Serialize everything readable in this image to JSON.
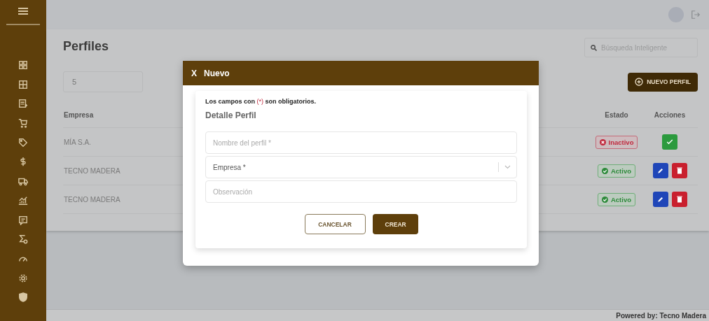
{
  "sidebar": {
    "items": [
      {
        "kind": "grid"
      },
      {
        "kind": "layout"
      },
      {
        "kind": "document"
      },
      {
        "kind": "cart"
      },
      {
        "kind": "tag"
      },
      {
        "kind": "dollar"
      },
      {
        "kind": "truck"
      },
      {
        "kind": "chart"
      },
      {
        "kind": "message"
      },
      {
        "kind": "sigma"
      },
      {
        "kind": "gauge"
      },
      {
        "kind": "gear"
      },
      {
        "kind": "shield"
      }
    ]
  },
  "page": {
    "title": "Perfiles",
    "search": {
      "placeholder": "Búsqueda Inteligente"
    },
    "page_size": "5",
    "new_button": "NUEVO PERFIL"
  },
  "table": {
    "columns": [
      "Empresa",
      "Estado",
      "Acciones"
    ],
    "rows": [
      {
        "empresa": "MÍA S.A.",
        "status": {
          "label": "Inactivo",
          "active": false
        },
        "actions": [
          {
            "kind": "activate"
          }
        ]
      },
      {
        "empresa": "TECNO MADERA",
        "status": {
          "label": "Activo",
          "active": true
        },
        "actions": [
          {
            "kind": "edit"
          },
          {
            "kind": "delete"
          }
        ]
      },
      {
        "empresa": "TECNO MADERA",
        "status": {
          "label": "Activo",
          "active": true
        },
        "actions": [
          {
            "kind": "edit"
          },
          {
            "kind": "delete"
          }
        ]
      }
    ]
  },
  "dialog": {
    "close": "X",
    "title": "Nuevo",
    "required_note": {
      "before": "Los campos con",
      "mark": "(*)",
      "after": "son obligatorios."
    },
    "section": "Detalle Perfil",
    "fields": [
      {
        "kind": "text",
        "placeholder": "Nombre del perfil *"
      },
      {
        "kind": "select",
        "placeholder": "Empresa *"
      },
      {
        "kind": "text",
        "placeholder": "Observación"
      }
    ],
    "buttons": [
      {
        "label": "CANCELAR",
        "kind": "secondary"
      },
      {
        "label": "CREAR",
        "kind": "primary"
      }
    ]
  },
  "footer": "Powered by: Tecno Madera"
}
